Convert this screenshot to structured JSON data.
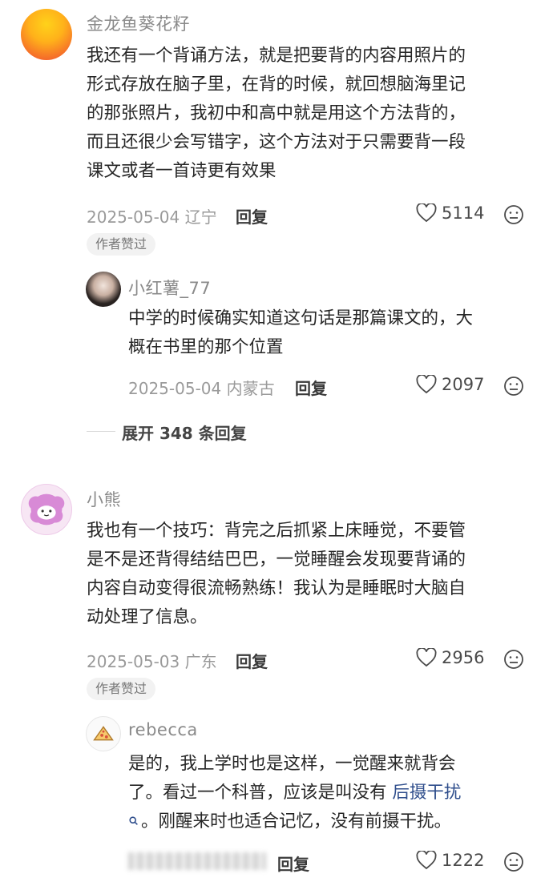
{
  "comments": [
    {
      "username": "金龙鱼葵花籽",
      "text": "我还有一个背诵方法，就是把要背的内容用照片的形式存放在脑子里，在背的时候，就回想脑海里记的那张照片，我初中和高中就是用这个方法背的，而且还很少会写错字，这个方法对于只需要背一段课文或者一首诗更有效果",
      "lines": [
        "我还有一个背诵方法，就是把要背的内容用照片的",
        "形式存放在脑子里，在背的时候，就回想脑海里记",
        "的那张照片，我初中和高中就是用这个方法背的，",
        "而且还很少会写错字，这个方法对于只需要背一段",
        "课文或者一首诗更有效果"
      ],
      "date": "2025-05-04",
      "location": "辽宁",
      "reply_label": "回复",
      "likes": "5114",
      "badge": "作者赞过",
      "reply": {
        "username": "小红薯_77",
        "lines": [
          "中学的时候确实知道这句话是那篇课文的，大",
          "概在书里的那个位置"
        ],
        "date": "2025-05-04",
        "location": "内蒙古",
        "reply_label": "回复",
        "likes": "2097"
      },
      "expand_label": "展开 348 条回复"
    },
    {
      "username": "小熊",
      "lines": [
        "我也有一个技巧：背完之后抓紧上床睡觉，不要管",
        "是不是还背得结结巴巴，一觉睡醒会发现要背诵的",
        "内容自动变得很流畅熟练！我认为是睡眠时大脑自",
        "动处理了信息。"
      ],
      "date": "2025-05-03",
      "location": "广东",
      "reply_label": "回复",
      "likes": "2956",
      "badge": "作者赞过",
      "reply": {
        "username": "rebecca",
        "line1": "是的，我上学时也是这样，一觉醒来就背会",
        "line2_pre": "了。看过一个科普，应该是叫没有 ",
        "line2_link": "后摄干扰",
        "line3_post": "。刚醒来时也适合记忆，没有前摄干扰。",
        "reply_label": "回复",
        "likes": "1222"
      }
    }
  ],
  "colors": {
    "accent_link": "#2f4e8c",
    "text": "#262626",
    "meta": "#9a9a9a"
  }
}
